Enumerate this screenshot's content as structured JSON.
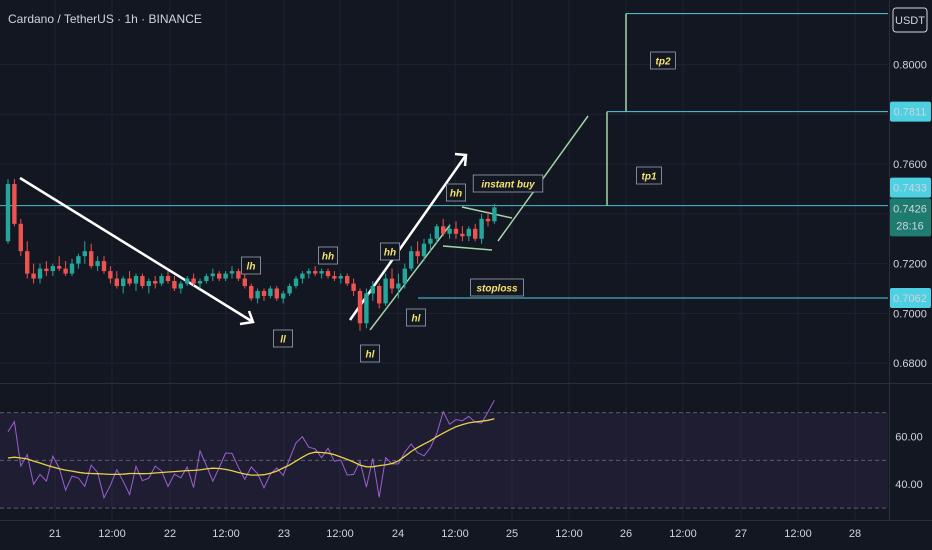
{
  "header": {
    "symbol_title": "Cardano / TetherUS · 1h · BINANCE"
  },
  "currency_label": "USDT",
  "colors": {
    "up": "#26a69a",
    "down": "#ef5350",
    "rsi": "#9c5fd0",
    "rsi_ma": "#e7d24b",
    "level": "#4dd0e1",
    "annotation": "#f7e36b"
  },
  "chart_data": [
    {
      "type": "candlestick",
      "title": "Cardano / TetherUS · 1h · BINANCE",
      "y_axis": {
        "min": 0.672,
        "max": 0.826,
        "ticks": [
          0.68,
          0.7,
          0.72,
          0.74,
          0.76,
          0.78,
          0.8
        ],
        "tick_labels": [
          "0.6800",
          "0.7000",
          "0.7200",
          "",
          "0.7600",
          "",
          "0.8000"
        ],
        "unit": "USDT"
      },
      "x_axis": {
        "tick_labels": [
          "21",
          "12:00",
          "22",
          "12:00",
          "23",
          "12:00",
          "24",
          "12:00",
          "25",
          "12:00",
          "26",
          "12:00",
          "27",
          "12:00",
          "28"
        ]
      },
      "price_tags": [
        {
          "value": 0.7811,
          "label": "0.7811",
          "style": "level"
        },
        {
          "value": 0.7433,
          "label": "0.7433",
          "style": "level"
        },
        {
          "value": 0.7426,
          "label": "0.7426",
          "countdown": "28:16",
          "style": "current"
        },
        {
          "value": 0.7062,
          "label": "0.7062",
          "style": "level"
        }
      ],
      "levels": [
        {
          "name": "tp2",
          "value": 0.8205
        },
        {
          "name": "tp1",
          "value": 0.7811
        },
        {
          "name": "entry",
          "value": 0.7433
        },
        {
          "name": "stoploss",
          "value": 0.7062
        }
      ],
      "annotations": [
        "lh",
        "ll",
        "hh",
        "hh",
        "hl",
        "hl",
        "hh",
        "instant buy",
        "stoploss",
        "tp1",
        "tp2"
      ],
      "candles": [
        [
          0.729,
          0.754,
          0.728,
          0.752
        ],
        [
          0.752,
          0.754,
          0.735,
          0.736
        ],
        [
          0.736,
          0.738,
          0.723,
          0.725
        ],
        [
          0.725,
          0.729,
          0.714,
          0.716
        ],
        [
          0.716,
          0.72,
          0.712,
          0.714
        ],
        [
          0.714,
          0.72,
          0.712,
          0.718
        ],
        [
          0.718,
          0.721,
          0.715,
          0.717
        ],
        [
          0.717,
          0.72,
          0.715,
          0.719
        ],
        [
          0.719,
          0.723,
          0.717,
          0.718
        ],
        [
          0.718,
          0.721,
          0.715,
          0.716
        ],
        [
          0.716,
          0.722,
          0.715,
          0.72
        ],
        [
          0.72,
          0.724,
          0.718,
          0.723
        ],
        [
          0.723,
          0.729,
          0.72,
          0.725
        ],
        [
          0.725,
          0.728,
          0.718,
          0.719
        ],
        [
          0.719,
          0.723,
          0.717,
          0.721
        ],
        [
          0.721,
          0.723,
          0.716,
          0.717
        ],
        [
          0.717,
          0.719,
          0.712,
          0.714
        ],
        [
          0.714,
          0.717,
          0.71,
          0.711
        ],
        [
          0.711,
          0.715,
          0.708,
          0.714
        ],
        [
          0.714,
          0.717,
          0.711,
          0.712
        ],
        [
          0.712,
          0.716,
          0.709,
          0.715
        ],
        [
          0.715,
          0.716,
          0.71,
          0.711
        ],
        [
          0.711,
          0.714,
          0.708,
          0.713
        ],
        [
          0.713,
          0.715,
          0.71,
          0.712
        ],
        [
          0.712,
          0.716,
          0.711,
          0.715
        ],
        [
          0.715,
          0.717,
          0.712,
          0.713
        ],
        [
          0.713,
          0.715,
          0.709,
          0.71
        ],
        [
          0.71,
          0.713,
          0.708,
          0.712
        ],
        [
          0.712,
          0.715,
          0.711,
          0.714
        ],
        [
          0.714,
          0.716,
          0.711,
          0.712
        ],
        [
          0.712,
          0.714,
          0.71,
          0.713
        ],
        [
          0.713,
          0.716,
          0.712,
          0.715
        ],
        [
          0.715,
          0.718,
          0.713,
          0.716
        ],
        [
          0.716,
          0.717,
          0.713,
          0.714
        ],
        [
          0.714,
          0.717,
          0.713,
          0.716
        ],
        [
          0.716,
          0.719,
          0.714,
          0.717
        ],
        [
          0.717,
          0.718,
          0.713,
          0.714
        ],
        [
          0.714,
          0.716,
          0.71,
          0.711
        ],
        [
          0.711,
          0.712,
          0.705,
          0.706
        ],
        [
          0.706,
          0.71,
          0.704,
          0.709
        ],
        [
          0.709,
          0.71,
          0.705,
          0.707
        ],
        [
          0.707,
          0.711,
          0.706,
          0.71
        ],
        [
          0.71,
          0.711,
          0.705,
          0.706
        ],
        [
          0.706,
          0.709,
          0.704,
          0.708
        ],
        [
          0.708,
          0.712,
          0.707,
          0.711
        ],
        [
          0.711,
          0.715,
          0.71,
          0.714
        ],
        [
          0.714,
          0.717,
          0.712,
          0.716
        ],
        [
          0.716,
          0.718,
          0.714,
          0.717
        ],
        [
          0.717,
          0.719,
          0.715,
          0.716
        ],
        [
          0.716,
          0.718,
          0.714,
          0.717
        ],
        [
          0.717,
          0.718,
          0.714,
          0.715
        ],
        [
          0.715,
          0.717,
          0.713,
          0.714
        ],
        [
          0.714,
          0.716,
          0.712,
          0.715
        ],
        [
          0.715,
          0.716,
          0.711,
          0.712
        ],
        [
          0.712,
          0.714,
          0.707,
          0.709
        ],
        [
          0.709,
          0.71,
          0.693,
          0.696
        ],
        [
          0.696,
          0.71,
          0.694,
          0.708
        ],
        [
          0.708,
          0.713,
          0.705,
          0.711
        ],
        [
          0.711,
          0.712,
          0.702,
          0.704
        ],
        [
          0.704,
          0.716,
          0.703,
          0.714
        ],
        [
          0.714,
          0.718,
          0.708,
          0.71
        ],
        [
          0.71,
          0.716,
          0.706,
          0.712
        ],
        [
          0.712,
          0.72,
          0.71,
          0.718
        ],
        [
          0.718,
          0.727,
          0.717,
          0.725
        ],
        [
          0.725,
          0.729,
          0.72,
          0.723
        ],
        [
          0.723,
          0.73,
          0.721,
          0.728
        ],
        [
          0.728,
          0.732,
          0.725,
          0.73
        ],
        [
          0.73,
          0.736,
          0.728,
          0.735
        ],
        [
          0.735,
          0.738,
          0.731,
          0.732
        ],
        [
          0.732,
          0.736,
          0.73,
          0.734
        ],
        [
          0.734,
          0.737,
          0.73,
          0.732
        ],
        [
          0.732,
          0.735,
          0.729,
          0.731
        ],
        [
          0.731,
          0.735,
          0.729,
          0.734
        ],
        [
          0.734,
          0.736,
          0.729,
          0.73
        ],
        [
          0.73,
          0.74,
          0.728,
          0.738
        ],
        [
          0.738,
          0.741,
          0.735,
          0.737
        ],
        [
          0.737,
          0.744,
          0.736,
          0.7426
        ]
      ]
    },
    {
      "type": "line",
      "title": "",
      "y_axis": {
        "min": 25,
        "max": 82,
        "tick_labels": [
          "60.00",
          "40.00"
        ],
        "ticks": [
          60,
          40
        ],
        "bands": [
          70,
          50,
          30
        ]
      },
      "series": [
        {
          "values": [
            62.0,
            66.2,
            47.6,
            52.4,
            40.0,
            44.1,
            41.3,
            51.8,
            46.8,
            37.5,
            43.4,
            42.6,
            39.1,
            48.0,
            44.9,
            34.3,
            39.6,
            46.1,
            41.2,
            35.7,
            47.5,
            41.5,
            42.5,
            47.6,
            45.5,
            39.1,
            44.2,
            42.7,
            47.2,
            38.6,
            53.9,
            47.8,
            41.3,
            46.9,
            53.1,
            52.9,
            47.1,
            42.0,
            47.2,
            44.4,
            38.5,
            44.3,
            46.8,
            43.7,
            50.7,
            57.3,
            59.9,
            55.5,
            54.8,
            51.1,
            55.1,
            49.6,
            50.2,
            43.8,
            44.1,
            49.6,
            38.8,
            50.8,
            34.5,
            51.1,
            48.5,
            48.5,
            53.4,
            56.9,
            53.2,
            51.9,
            55.3,
            61.2,
            70.4,
            65.1,
            67.1,
            66.6,
            68.4,
            66.0,
            65.6,
            70.3,
            75.2
          ]
        },
        {
          "values": [
            51.0,
            51.3,
            51.0,
            50.6,
            49.7,
            48.9,
            48.0,
            47.2,
            46.5,
            45.9,
            45.5,
            45.0,
            44.6,
            44.5,
            44.4,
            44.3,
            44.1,
            44.1,
            44.2,
            44.5,
            44.5,
            44.4,
            44.5,
            44.7,
            44.9,
            45.1,
            45.3,
            45.5,
            45.7,
            45.8,
            46.0,
            46.4,
            46.7,
            46.6,
            46.2,
            45.6,
            44.9,
            44.3,
            43.8,
            43.8,
            44.0,
            44.6,
            45.5,
            46.8,
            48.1,
            49.7,
            51.3,
            52.8,
            53.4,
            53.3,
            53.0,
            52.4,
            51.4,
            50.4,
            49.3,
            48.0,
            47.3,
            47.3,
            47.8,
            48.1,
            48.7,
            49.8,
            51.7,
            53.7,
            55.4,
            56.8,
            58.2,
            59.9,
            61.4,
            62.8,
            64.1,
            65.0,
            65.7,
            66.1,
            66.4,
            66.8,
            67.4
          ]
        }
      ]
    }
  ]
}
